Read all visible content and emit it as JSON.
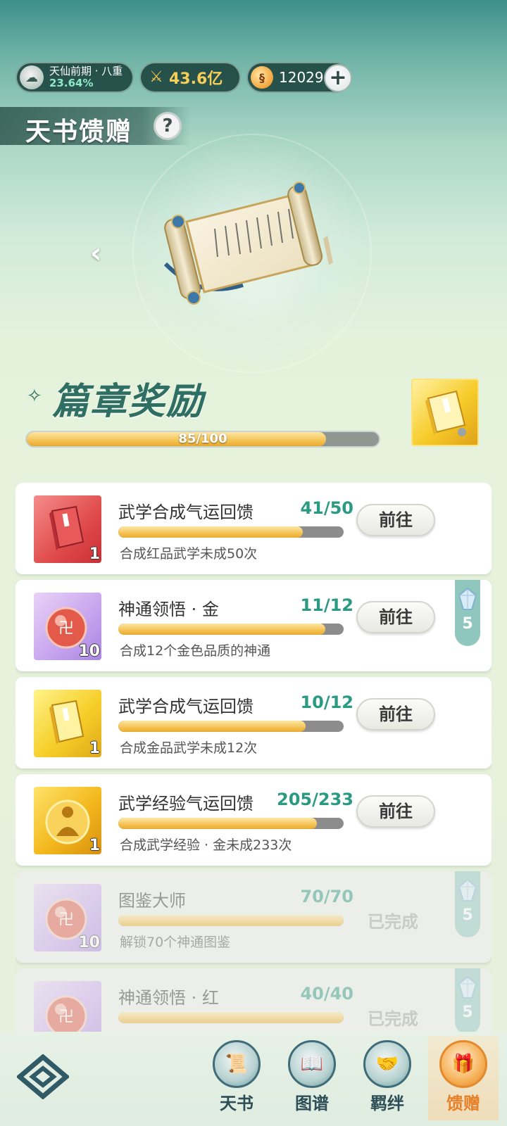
{
  "status": {
    "rank_title": "天仙前期 · 八重",
    "rank_percent": "23.64%",
    "power": "43.6亿",
    "coins": "12029",
    "add_symbol": "+"
  },
  "header": {
    "title": "天书馈赠",
    "help_symbol": "?"
  },
  "scroll": {
    "prev_symbol": "‹"
  },
  "chapter": {
    "mark": "✧",
    "title": "篇章奖励",
    "progress": "85/100",
    "progress_value": 0.85
  },
  "tasks": [
    {
      "title": "武学合成气运回馈",
      "count": "41/50",
      "progress": 0.82,
      "desc": "合成红品武学未成50次",
      "qty": "1",
      "icon": "red-book-icon",
      "action": "前往"
    },
    {
      "title": "神通领悟 · 金",
      "count": "11/12",
      "progress": 0.92,
      "desc": "合成12个金色品质的神通",
      "qty": "10",
      "icon": "red-orb-icon",
      "action": "前往",
      "side_reward": "5"
    },
    {
      "title": "武学合成气运回馈",
      "count": "10/12",
      "progress": 0.83,
      "desc": "合成金品武学未成12次",
      "qty": "1",
      "icon": "gold-book-icon",
      "action": "前往"
    },
    {
      "title": "武学经验气运回馈",
      "count": "205/233",
      "progress": 0.88,
      "desc": "合成武学经验 · 金未成233次",
      "qty": "1",
      "icon": "golden-figure-orb-icon",
      "action": "前往"
    },
    {
      "title": "图鉴大师",
      "count": "70/70",
      "progress": 1.0,
      "desc": "解锁70个神通图鉴",
      "qty": "10",
      "icon": "red-orb-icon",
      "status": "已完成",
      "side_reward": "5"
    },
    {
      "title": "神通领悟 · 红",
      "count": "40/40",
      "progress": 1.0,
      "desc": "",
      "qty": "",
      "icon": "red-orb-icon",
      "status": "已完成",
      "side_reward": "5"
    }
  ],
  "nav": [
    {
      "label": "天书",
      "icon": "scroll-book-icon"
    },
    {
      "label": "图谱",
      "icon": "atlas-icon"
    },
    {
      "label": "羁绊",
      "icon": "handshake-icon"
    },
    {
      "label": "馈赠",
      "icon": "gift-bag-icon",
      "active": true
    }
  ],
  "colors": {
    "accent_teal": "#2b9a82",
    "progress_gold": "#f4c254",
    "nav_active": "#e6812a"
  }
}
